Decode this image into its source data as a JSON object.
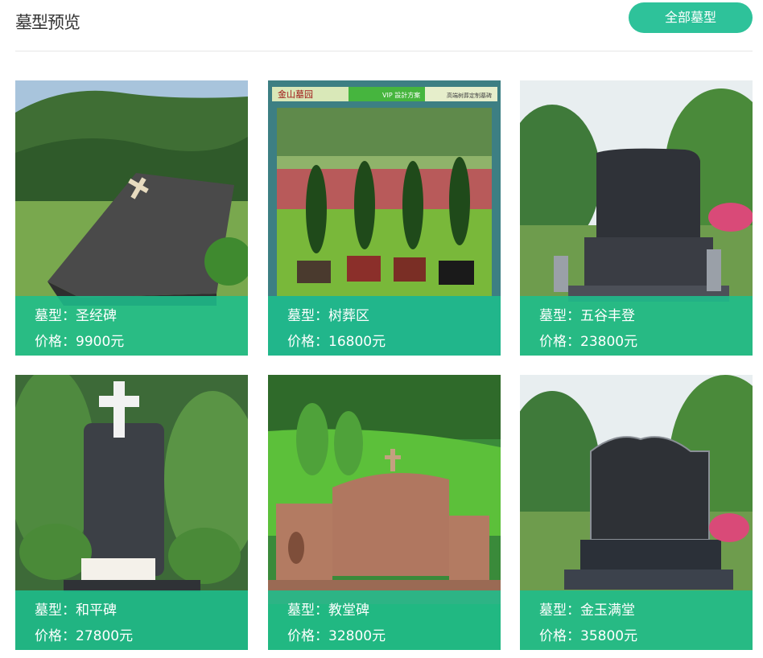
{
  "header": {
    "title": "墓型预览",
    "all_button": "全部墓型"
  },
  "cards": [
    {
      "type_line": "墓型：圣经碑",
      "price_line": "价格：9900元",
      "scene": "bible-tombstone"
    },
    {
      "type_line": "墓型：树葬区",
      "price_line": "价格：16800元",
      "scene": "tree-burial",
      "banner": {
        "left": "金山墓园",
        "mid": "VIP  設計方案",
        "right": "高端树葬定制墓碑"
      }
    },
    {
      "type_line": "墓型：五谷丰登",
      "price_line": "价格：23800元",
      "scene": "dark-upright-tombstone"
    },
    {
      "type_line": "墓型：和平碑",
      "price_line": "价格：27800元",
      "scene": "cross-tombstone"
    },
    {
      "type_line": "墓型：教堂碑",
      "price_line": "价格：32800元",
      "scene": "red-granite-tombstone"
    },
    {
      "type_line": "墓型：金玉满堂",
      "price_line": "价格：35800元",
      "scene": "dark-arched-tombstone"
    }
  ],
  "colors": {
    "accent": "#2ec29a",
    "overlay": "#1ebe8c"
  }
}
